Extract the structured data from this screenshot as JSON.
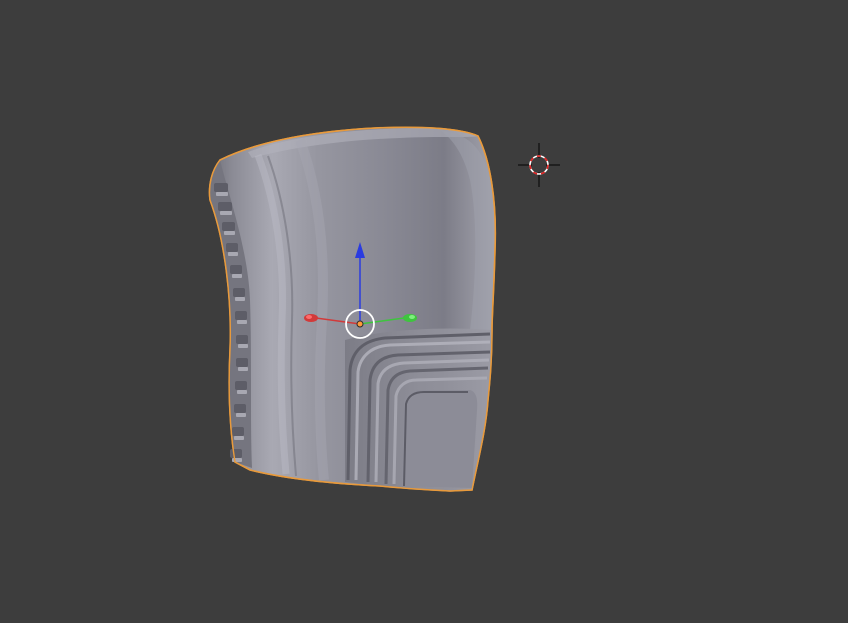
{
  "viewport": {
    "background_color": "#3d3d3d",
    "mode": "3d-viewport"
  },
  "selected_object": {
    "selected": true,
    "outline_color": "#e89a3c",
    "surface_color": "#8e8e98"
  },
  "transform_gizmo": {
    "visible": true,
    "x_axis_color": "#d23a3a",
    "y_axis_color": "#3ec53e",
    "z_axis_color": "#2a3be0",
    "origin_color": "#ff9a3a"
  },
  "cursor_3d": {
    "visible": true,
    "icon": "3d-cursor-icon"
  }
}
